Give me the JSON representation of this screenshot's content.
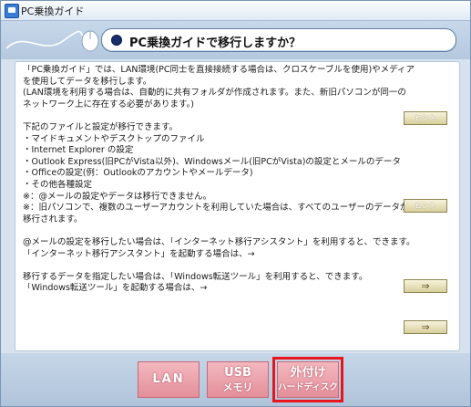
{
  "window": {
    "title": "PC乗換ガイド"
  },
  "header": {
    "title": "PC乗換ガイドで移行しますか？"
  },
  "content": {
    "lines": [
      "「PC乗換ガイド」では、LAN環境(PC同士を直接接続する場合は、クロスケーブルを使用)やメディア",
      "を使用してデータを移行します。",
      "(LAN環境を利用する場合は、自動的に共有フォルダが作成されます。また、新旧パソコンが同一の",
      "ネットワーク上に存在する必要があります。)",
      "",
      "下記のファイルと設定が移行できます。",
      "・マイドキュメントやデスクトップのファイル",
      "・Internet Explorer の設定",
      "・Outlook Express(旧PCがVista以外)、Windowsメール(旧PCがVista)の設定とメールのデータ",
      "・Officeの設定(例：Outlookのアカウントやメールデータ)",
      "・その他各種設定",
      "※：@メールの設定やデータは移行できません。",
      "※：旧パソコンで、複数のユーザーアカウントを利用していた場合は、すべてのユーザーのデータが",
      "移行されます。",
      "",
      "@メールの設定を移行したい場合は、「インターネット移行アシスタント」を利用すると、できます。",
      "「インターネット移行アシスタント」を起動する場合は、→",
      "",
      "移行するデータを指定したい場合は、「Windows転送ツール」を利用すると、できます。",
      "「Windows転送ツール」を起動する場合は、→"
    ],
    "hint_label": "ヒント",
    "arrow_label": "⇒"
  },
  "footer": {
    "lan": {
      "label": "LAN"
    },
    "usb": {
      "line1": "USB",
      "line2": "メモリ"
    },
    "external": {
      "line1": "外付け",
      "line2": "ハードディスク"
    }
  },
  "colors": {
    "accent_selected": "#e8141e",
    "footer_button": "#e9a0aa",
    "hint_button": "#e6dfb4"
  }
}
